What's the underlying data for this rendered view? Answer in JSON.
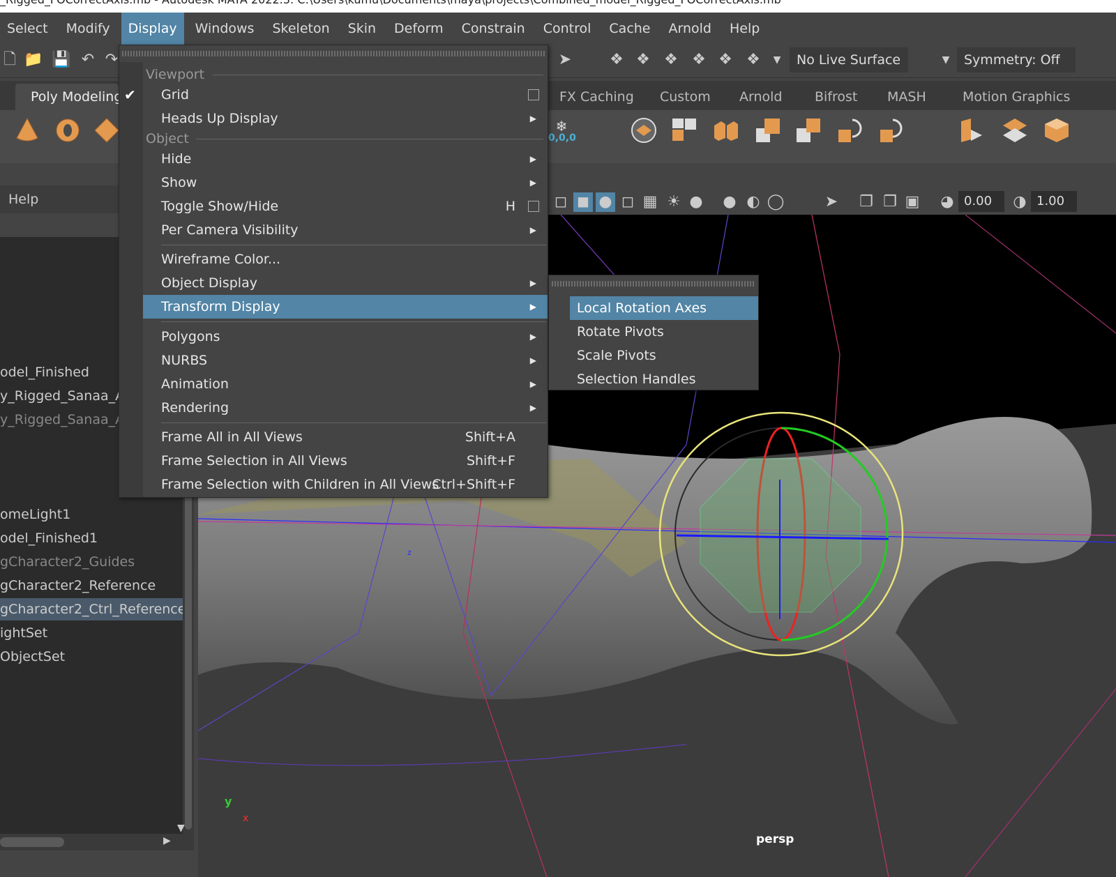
{
  "title_bar": {
    "text": "_Rigged_FOCorrectAxis.mb - Autodesk MAYA 2022.3: C:\\Users\\kumu\\Documents\\maya\\projects\\Combined_model_Rigged_FOCorrectAxis.mb"
  },
  "menubar": {
    "items": [
      "Select",
      "Modify",
      "Display",
      "Windows",
      "Skeleton",
      "Skin",
      "Deform",
      "Constrain",
      "Control",
      "Cache",
      "Arnold",
      "Help"
    ],
    "active": "Display"
  },
  "status_line": {
    "live_surface": "No Live Surface",
    "symmetry": "Symmetry: Off"
  },
  "shelf_tabs": {
    "poly_modeling": "Poly Modeling",
    "fx_caching": "FX Caching",
    "custom": "Custom",
    "arnold": "Arnold",
    "bifrost": "Bifrost",
    "mash": "MASH",
    "motion_graphics": "Motion Graphics"
  },
  "shelf": {
    "snow_label": "0,0,0"
  },
  "left_panel": {
    "help": "Help"
  },
  "outliner": {
    "items": [
      {
        "label": "odel_Finished",
        "state": "normal"
      },
      {
        "label": "y_Rigged_Sanaa_Ani",
        "state": "normal"
      },
      {
        "label": "y_Rigged_Sanaa_Ani",
        "state": "dim"
      },
      {
        "label": "omeLight1",
        "state": "normal"
      },
      {
        "label": "odel_Finished1",
        "state": "normal"
      },
      {
        "label": "gCharacter2_Guides",
        "state": "dim"
      },
      {
        "label": "gCharacter2_Reference",
        "state": "normal"
      },
      {
        "label": "gCharacter2_Ctrl_Reference",
        "state": "selected"
      },
      {
        "label": "ightSet",
        "state": "normal"
      },
      {
        "label": "ObjectSet",
        "state": "normal"
      }
    ]
  },
  "viewport_toolbar": {
    "exposure": "0.00",
    "gamma": "1.00"
  },
  "viewport": {
    "camera": "persp",
    "axis_y": "y",
    "axis_x": "x",
    "axis_z_label": "z"
  },
  "display_menu": {
    "section_viewport": "Viewport",
    "grid": "Grid",
    "heads_up_display": "Heads Up Display",
    "section_object": "Object",
    "hide": "Hide",
    "show": "Show",
    "toggle_show_hide": "Toggle Show/Hide",
    "toggle_show_hide_shortcut": "H",
    "per_camera_visibility": "Per Camera Visibility",
    "wireframe_color": "Wireframe Color...",
    "object_display": "Object Display",
    "transform_display": "Transform Display",
    "polygons": "Polygons",
    "nurbs": "NURBS",
    "animation": "Animation",
    "rendering": "Rendering",
    "frame_all": "Frame All in All Views",
    "frame_all_shortcut": "Shift+A",
    "frame_selection": "Frame Selection in All Views",
    "frame_selection_shortcut": "Shift+F",
    "frame_selection_children": "Frame Selection with Children in All Views",
    "frame_selection_children_shortcut": "Ctrl+Shift+F"
  },
  "transform_display_submenu": {
    "local_rotation_axes": "Local Rotation Axes",
    "rotate_pivots": "Rotate Pivots",
    "scale_pivots": "Scale Pivots",
    "selection_handles": "Selection Handles"
  },
  "colors": {
    "accent": "#5285a6",
    "menu_bg": "#444444",
    "viewport_bg": "#000000",
    "shelf_icon": "#e39a4f"
  }
}
